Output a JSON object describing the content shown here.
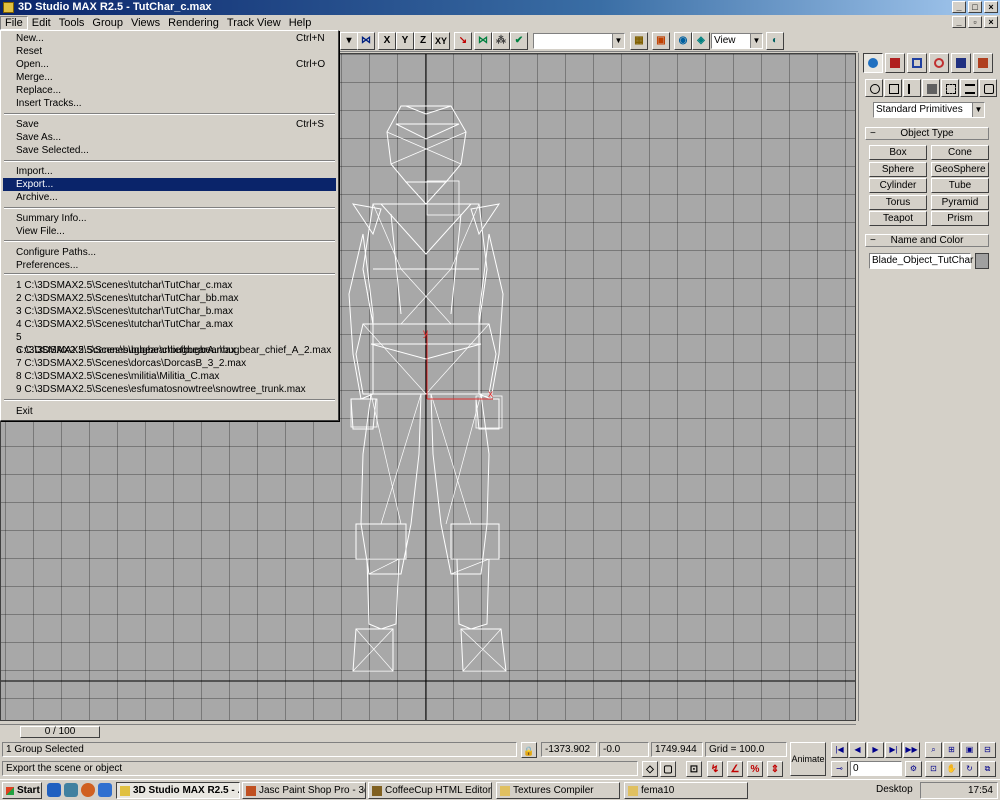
{
  "window": {
    "title": "3D Studio MAX R2.5 - TutChar_c.max"
  },
  "menubar": [
    "File",
    "Edit",
    "Tools",
    "Group",
    "Views",
    "Rendering",
    "Track View",
    "Help"
  ],
  "toolbar": {
    "axis_x": "X",
    "axis_y": "Y",
    "axis_z": "Z",
    "axis_xy": "XY",
    "view_combo": "View",
    "selection_set": ""
  },
  "file_menu": {
    "items": [
      {
        "label": "New...",
        "shortcut": "Ctrl+N"
      },
      {
        "label": "Reset",
        "shortcut": ""
      },
      {
        "label": "Open...",
        "shortcut": "Ctrl+O"
      },
      {
        "label": "Merge...",
        "shortcut": ""
      },
      {
        "label": "Replace...",
        "shortcut": ""
      },
      {
        "label": "Insert Tracks...",
        "shortcut": ""
      },
      {
        "label": "Save",
        "shortcut": "Ctrl+S"
      },
      {
        "label": "Save As...",
        "shortcut": ""
      },
      {
        "label": "Save Selected...",
        "shortcut": ""
      },
      {
        "label": "Import...",
        "shortcut": ""
      },
      {
        "label": "Export...",
        "shortcut": ""
      },
      {
        "label": "Archive...",
        "shortcut": ""
      },
      {
        "label": "Summary Info...",
        "shortcut": ""
      },
      {
        "label": "View File...",
        "shortcut": ""
      },
      {
        "label": "Configure Paths...",
        "shortcut": ""
      },
      {
        "label": "Preferences...",
        "shortcut": ""
      },
      {
        "label": "1 C:\\3DSMAX2.5\\Scenes\\tutchar\\TutChar_c.max",
        "shortcut": ""
      },
      {
        "label": "2 C:\\3DSMAX2.5\\Scenes\\tutchar\\TutChar_bb.max",
        "shortcut": ""
      },
      {
        "label": "3 C:\\3DSMAX2.5\\Scenes\\tutchar\\TutChar_b.max",
        "shortcut": ""
      },
      {
        "label": "4 C:\\3DSMAX2.5\\Scenes\\tutchar\\TutChar_a.max",
        "shortcut": ""
      },
      {
        "label": "5 C:\\3DSMAX2.5\\Scenes\\bugbear\\chiefbugbear\\bugbear_chief_A_2.max",
        "shortcut": ""
      },
      {
        "label": "6 C:\\3DSMAX2.5\\Scenes\\bugbear\\bugbearA.max",
        "shortcut": ""
      },
      {
        "label": "7 C:\\3DSMAX2.5\\Scenes\\dorcas\\DorcasB_3_2.max",
        "shortcut": ""
      },
      {
        "label": "8 C:\\3DSMAX2.5\\Scenes\\militia\\Militia_C.max",
        "shortcut": ""
      },
      {
        "label": "9 C:\\3DSMAX2.5\\Scenes\\esfumatosnowtree\\snowtree_trunk.max",
        "shortcut": ""
      },
      {
        "label": "Exit",
        "shortcut": ""
      }
    ],
    "highlighted": "Export..."
  },
  "command_panel": {
    "category": "Standard Primitives",
    "object_type_title": "Object Type",
    "buttons": [
      "Box",
      "Cone",
      "Sphere",
      "GeoSphere",
      "Cylinder",
      "Tube",
      "Torus",
      "Pyramid",
      "Teapot",
      "Prism"
    ],
    "name_color_title": "Name and Color",
    "object_name": "Blade_Object_TutChar",
    "color": "#a0a0a0"
  },
  "timeline": {
    "frame_label": "0 / 100"
  },
  "status": {
    "selection": "1 Group Selected",
    "prompt": "Export the scene or object",
    "x": "-1373.902",
    "y": "-0.0",
    "z": "1749.944",
    "grid": "Grid = 100.0",
    "animate_label": "Animate",
    "current_frame": "0"
  },
  "taskbar": {
    "start": "Start",
    "tasks": [
      "3D Studio MAX R2.5 - ...",
      "Jasc Paint Shop Pro - 3d...",
      "CoffeeCup HTML Editor",
      "Textures Compiler",
      "fema10"
    ],
    "desktop_label": "Desktop",
    "clock": "17:54"
  },
  "colors": {
    "title_start": "#0a246a",
    "highlight": "#0a246a",
    "viewport_bg": "#a8a8a8",
    "wireframe": "#ffffff",
    "axis": "#e03030"
  }
}
